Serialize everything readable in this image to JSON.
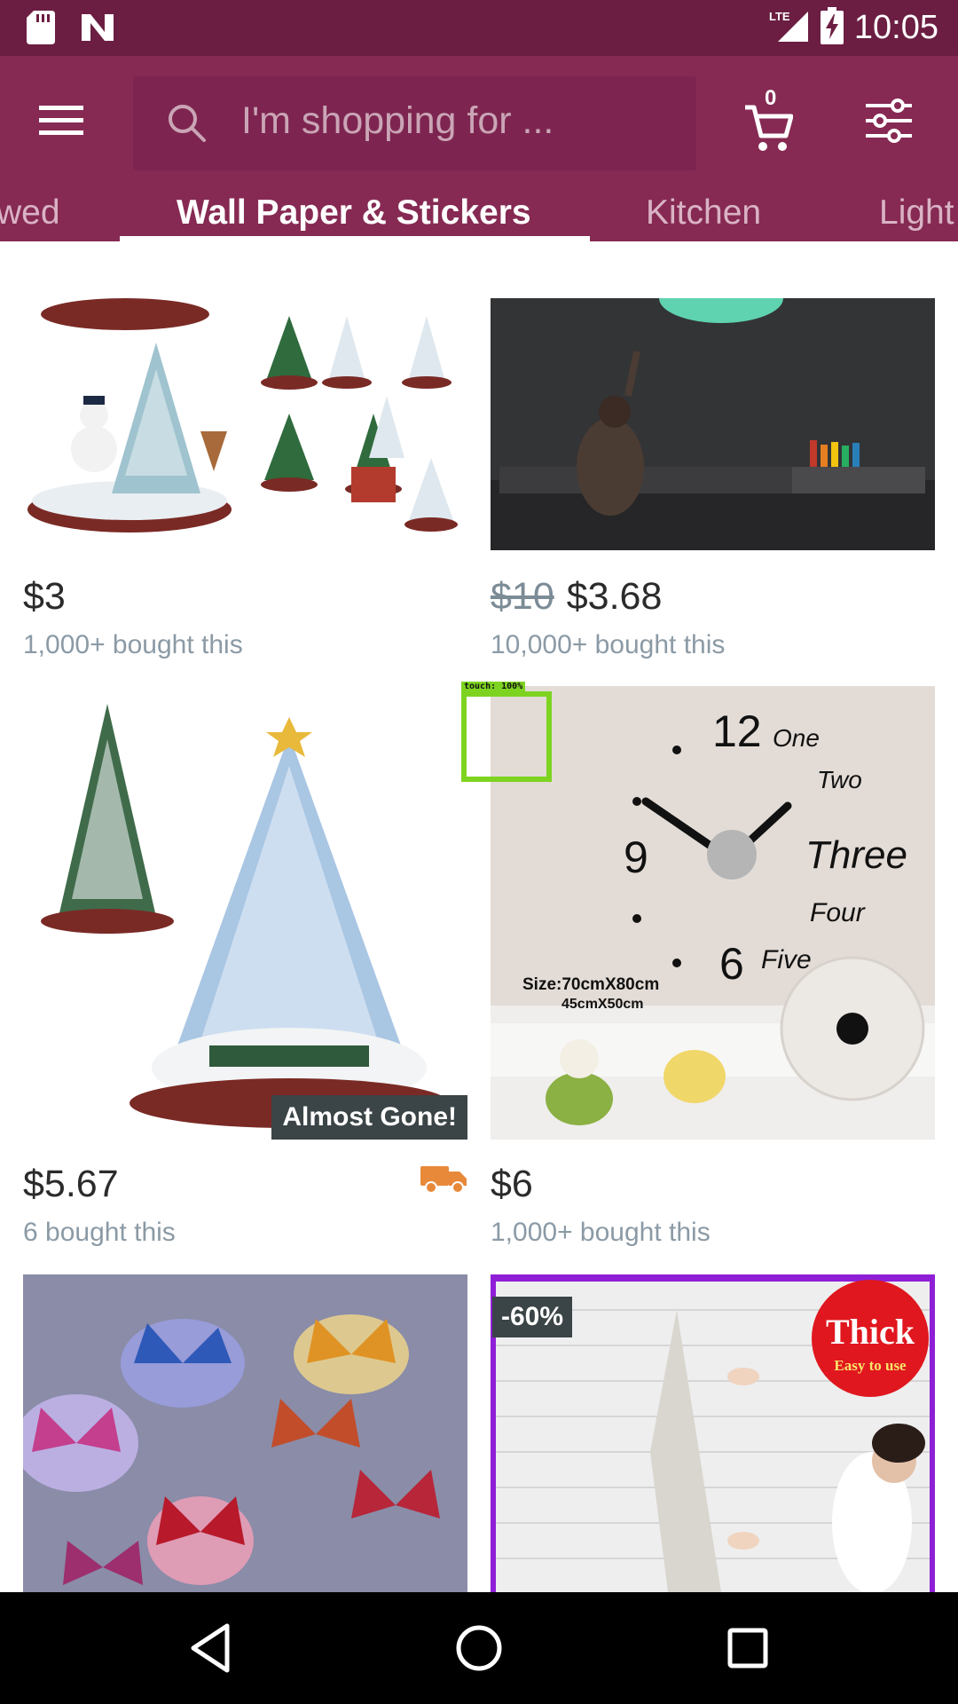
{
  "status_bar": {
    "time": "10:05",
    "network": "LTE",
    "icons": [
      "sd-card-icon",
      "n-notification-icon",
      "signal-icon",
      "battery-charging-icon"
    ]
  },
  "header": {
    "search_placeholder": "I'm shopping for ...",
    "cart_count": "0",
    "icons": [
      "menu-icon",
      "search-icon",
      "cart-icon",
      "filter-icon"
    ]
  },
  "tabs": [
    {
      "label": "wed",
      "active": false
    },
    {
      "label": "Wall Paper & Stickers",
      "active": true
    },
    {
      "label": "Kitchen",
      "active": false
    },
    {
      "label": "Light",
      "active": false
    }
  ],
  "products": [
    {
      "price": "$3",
      "old_price": "",
      "bought": "1,000+ bought this",
      "image": "christmas tree music box collage"
    },
    {
      "price": "$3.68",
      "old_price": "$10",
      "bought": "10,000+ bought this",
      "image": "glow in the dark moon wall sticker"
    },
    {
      "price": "$5.67",
      "old_price": "",
      "bought": "6 bought this",
      "badge": "Almost Gone!",
      "image": "crystal christmas tree with train"
    },
    {
      "price": "$6",
      "old_price": "",
      "bought": "1,000+ bought this",
      "image": "3D wall clock with number words",
      "clock_text": {
        "size": "Size:70cmX80cm",
        "size_alt": "45cmX50cm",
        "words": [
          "One",
          "Two",
          "Three",
          "Four",
          "Five"
        ],
        "numerals": [
          "12",
          "9",
          "6"
        ]
      }
    },
    {
      "price": "",
      "bought": "",
      "image": "LED butterfly wall lights"
    },
    {
      "price": "",
      "bought": "",
      "badge": "-60%",
      "image": "3D brick foam wallpaper",
      "stamp": {
        "title": "Thick",
        "subtitle": "Easy to use"
      }
    }
  ],
  "touch_indicator": {
    "label": "touch: 100%"
  },
  "colors": {
    "status_bar": "#6b1e42",
    "app_bar": "#862a53",
    "badge": "#3b4446",
    "truck": "#e8893a",
    "touch": "#7ed321"
  },
  "nav_bar": {
    "icons": [
      "back-icon",
      "home-icon",
      "recents-icon"
    ]
  }
}
